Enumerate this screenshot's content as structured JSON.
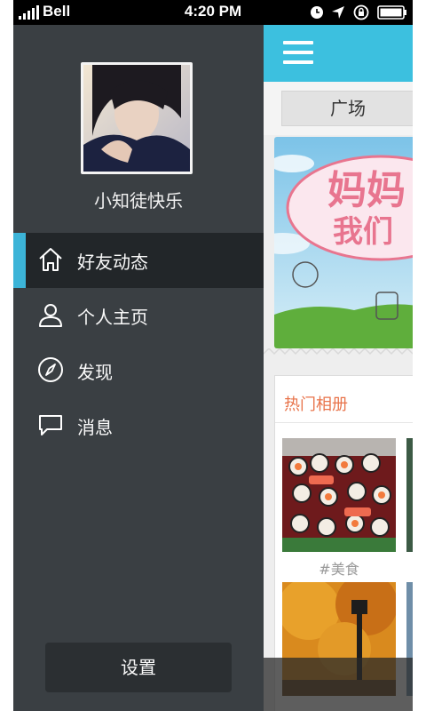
{
  "status_bar": {
    "carrier": "Bell",
    "time": "4:20 PM"
  },
  "drawer": {
    "username": "小知徒快乐",
    "menu": [
      {
        "label": "好友动态",
        "icon": "home-icon",
        "active": true
      },
      {
        "label": "个人主页",
        "icon": "person-icon",
        "active": false
      },
      {
        "label": "发现",
        "icon": "compass-icon",
        "active": false
      },
      {
        "label": "消息",
        "icon": "chat-bubble-icon",
        "active": false
      }
    ],
    "settings_label": "设置"
  },
  "main": {
    "tab_label": "广场",
    "banner_text_1": "妈妈",
    "banner_text_2": "我们",
    "hot_albums_title": "热门相册",
    "album_tag": "#美食"
  },
  "colors": {
    "accent": "#3cc0df",
    "drawer_bg": "#3a3f43",
    "active_bg": "#222629",
    "album_title": "#e8734a"
  }
}
